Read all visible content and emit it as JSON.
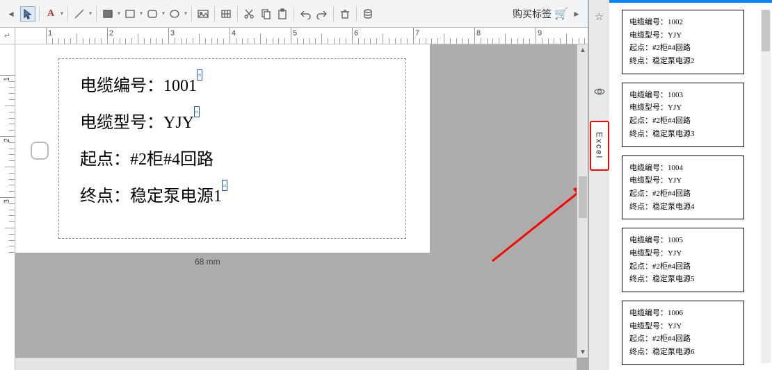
{
  "toolbar": {
    "buy_label": "购买标签"
  },
  "ruler_h": [
    "1",
    "2",
    "3",
    "4",
    "5",
    "6",
    "7",
    "8",
    "9"
  ],
  "ruler_v": [
    "1",
    "2",
    "3"
  ],
  "label": {
    "field_key_1": "电缆编号：",
    "field_val_1": "1001",
    "field_key_2": "电缆型号：",
    "field_val_2": "YJY",
    "field_key_3": "起点：",
    "field_val_3": "#2柜#4回路",
    "field_key_4": "终点：",
    "field_val_4": "稳定泵电源1"
  },
  "page_size": "68 mm",
  "side_tabs": {
    "star": "☆",
    "eye": "◉",
    "excel": "Excel"
  },
  "previews": [
    {
      "l1k": "电缆编号：",
      "l1v": "1002",
      "l2k": "电缆型号：",
      "l2v": "YJY",
      "l3k": "起点：",
      "l3v": "#2柜#4回路",
      "l4k": "终点：",
      "l4v": "稳定泵电源2"
    },
    {
      "l1k": "电缆编号：",
      "l1v": "1003",
      "l2k": "电缆型号：",
      "l2v": "YJY",
      "l3k": "起点：",
      "l3v": "#2柜#4回路",
      "l4k": "终点：",
      "l4v": "稳定泵电源3"
    },
    {
      "l1k": "电缆编号：",
      "l1v": "1004",
      "l2k": "电缆型号：",
      "l2v": "YJY",
      "l3k": "起点：",
      "l3v": "#2柜#4回路",
      "l4k": "终点：",
      "l4v": "稳定泵电源4"
    },
    {
      "l1k": "电缆编号：",
      "l1v": "1005",
      "l2k": "电缆型号：",
      "l2v": "YJY",
      "l3k": "起点：",
      "l3v": "#2柜#4回路",
      "l4k": "终点：",
      "l4v": "稳定泵电源5"
    },
    {
      "l1k": "电缆编号：",
      "l1v": "1006",
      "l2k": "电缆型号：",
      "l2v": "YJY",
      "l3k": "起点：",
      "l3v": "#2柜#4回路",
      "l4k": "终点：",
      "l4v": "稳定泵电源6"
    }
  ]
}
